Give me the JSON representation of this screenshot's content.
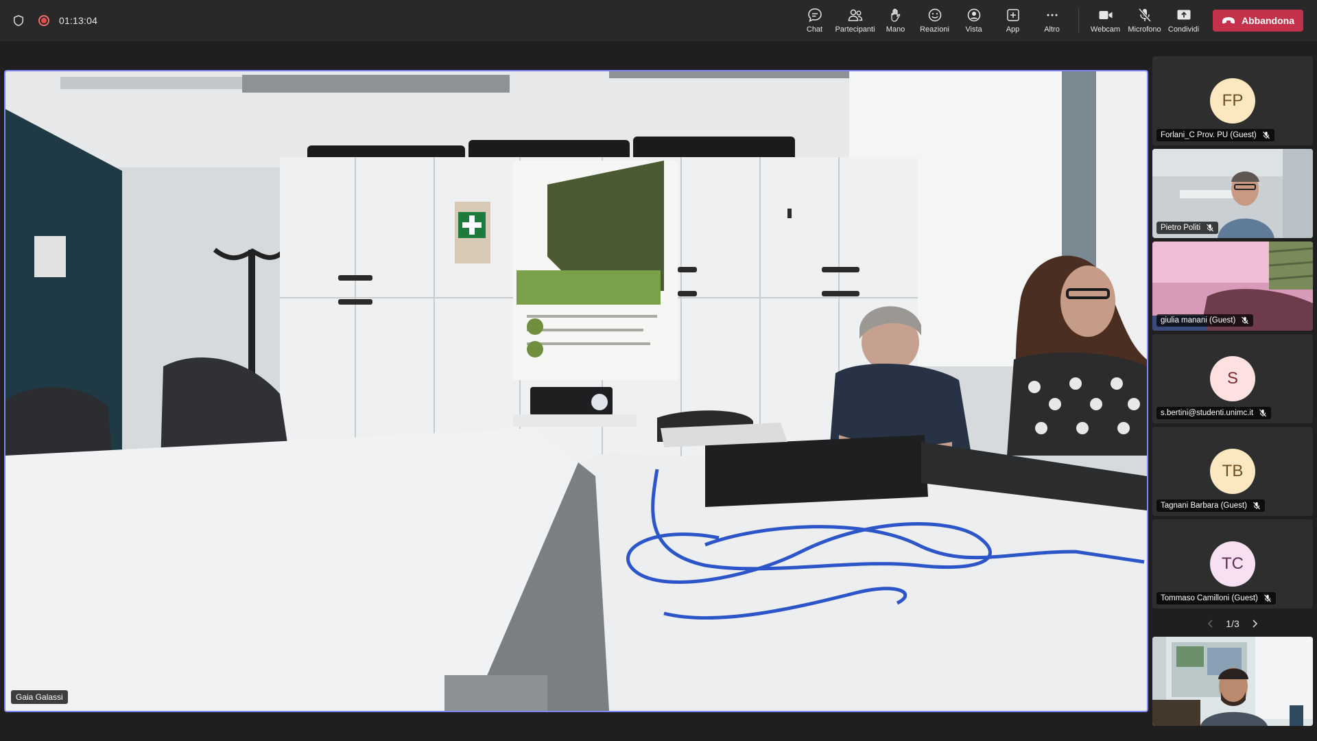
{
  "toolbar": {
    "timer": "01:13:04",
    "buttons": {
      "chat": "Chat",
      "participants": "Partecipanti",
      "hand": "Mano",
      "reactions": "Reazioni",
      "view": "Vista",
      "apps": "App",
      "more": "Altro",
      "camera": "Webcam",
      "mic": "Microfono",
      "share": "Condividi"
    },
    "leave_label": "Abbandona",
    "leave_color": "#c4314b",
    "icons": {
      "security": "shield-icon",
      "recording": "recording-icon",
      "chat": "chat-icon",
      "participants": "people-icon",
      "hand": "raise-hand-icon",
      "reactions": "smiley-icon",
      "view": "view-icon",
      "apps": "plus-square-icon",
      "more": "more-icon",
      "camera": "video-camera-icon",
      "mic": "mic-off-icon",
      "share": "share-screen-icon",
      "leave": "phone-hangup-icon"
    }
  },
  "main_stage": {
    "speaker_name": "Gaia Galassi",
    "highlight_color": "#7f85f5"
  },
  "participants": [
    {
      "initials": "FP",
      "name": "Forlani_C Prov. PU (Guest)",
      "muted": true
    },
    {
      "initials": "",
      "name": "Pietro Politi",
      "muted": true,
      "video": true
    },
    {
      "initials": "",
      "name": "giulia manani (Guest)",
      "muted": true,
      "video": true
    },
    {
      "initials": "S",
      "name": "s.bertini@studenti.unimc.it",
      "muted": true
    },
    {
      "initials": "TB",
      "name": "Tagnani Barbara (Guest)",
      "muted": true
    },
    {
      "initials": "TC",
      "name": "Tommaso Camilloni (Guest)",
      "muted": true
    }
  ],
  "pagination": {
    "label": "1/3"
  }
}
